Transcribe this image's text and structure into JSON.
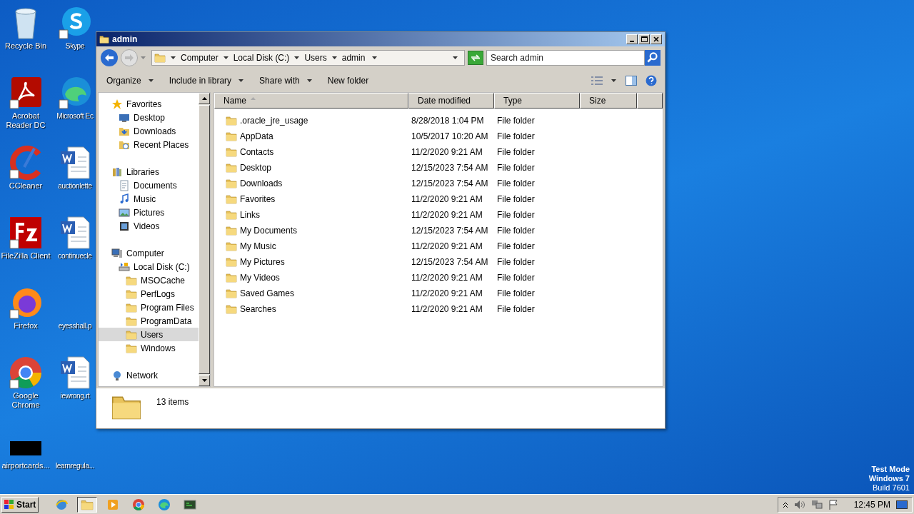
{
  "desktop_icons": [
    {
      "label": "Recycle Bin",
      "kind": "recycle"
    },
    {
      "label": "Skype",
      "kind": "skype"
    },
    {
      "label": "Acrobat Reader DC",
      "kind": "acrobat"
    },
    {
      "label": "Microsoft Ec",
      "kind": "edge"
    },
    {
      "label": "CCleaner",
      "kind": "ccleaner"
    },
    {
      "label": "auctionlette",
      "kind": "word"
    },
    {
      "label": "FileZilla Client",
      "kind": "filezilla"
    },
    {
      "label": "continuecle",
      "kind": "word"
    },
    {
      "label": "Firefox",
      "kind": "firefox"
    },
    {
      "label": "eyesshall.p",
      "kind": "blank"
    },
    {
      "label": "Google Chrome",
      "kind": "chrome"
    },
    {
      "label": "iewrong.rt",
      "kind": "word"
    },
    {
      "label": "airportcards...",
      "kind": "redacted"
    },
    {
      "label": "learnregula...",
      "kind": "blank"
    }
  ],
  "window": {
    "title": "admin",
    "breadcrumbs": [
      "Computer",
      "Local Disk (C:)",
      "Users",
      "admin"
    ],
    "search": {
      "placeholder": "Search admin"
    },
    "toolbar": [
      {
        "label": "Organize",
        "dropdown": true
      },
      {
        "label": "Include in library",
        "dropdown": true
      },
      {
        "label": "Share with",
        "dropdown": true
      },
      {
        "label": "New folder",
        "dropdown": false
      }
    ],
    "nav": [
      {
        "label": "Favorites",
        "kind": "star",
        "selected": false,
        "children": [
          {
            "label": "Desktop",
            "kind": "desktop",
            "selected": false
          },
          {
            "label": "Downloads",
            "kind": "download",
            "selected": false
          },
          {
            "label": "Recent Places",
            "kind": "recent",
            "selected": false
          }
        ]
      },
      {
        "label": "Libraries",
        "kind": "library",
        "selected": false,
        "children": [
          {
            "label": "Documents",
            "kind": "docs",
            "selected": false
          },
          {
            "label": "Music",
            "kind": "music",
            "selected": false
          },
          {
            "label": "Pictures",
            "kind": "pictures",
            "selected": false
          },
          {
            "label": "Videos",
            "kind": "videos",
            "selected": false
          }
        ]
      },
      {
        "label": "Computer",
        "kind": "computer",
        "selected": false,
        "children": [
          {
            "label": "Local Disk (C:)",
            "kind": "disk",
            "selected": false,
            "children": [
              {
                "label": "MSOCache",
                "kind": "folder",
                "selected": false
              },
              {
                "label": "PerfLogs",
                "kind": "folder",
                "selected": false
              },
              {
                "label": "Program Files",
                "kind": "folder",
                "selected": false
              },
              {
                "label": "ProgramData",
                "kind": "folder",
                "selected": false
              },
              {
                "label": "Users",
                "kind": "folder",
                "selected": true
              },
              {
                "label": "Windows",
                "kind": "folder",
                "selected": false
              }
            ]
          }
        ]
      },
      {
        "label": "Network",
        "kind": "network",
        "selected": false
      }
    ],
    "columns": [
      {
        "label": "Name",
        "sorted": true
      },
      {
        "label": "Date modified",
        "sorted": false
      },
      {
        "label": "Type",
        "sorted": false
      },
      {
        "label": "Size",
        "sorted": false
      }
    ],
    "rows": [
      {
        "name": ".oracle_jre_usage",
        "date": "8/28/2018 1:04 PM",
        "type": "File folder"
      },
      {
        "name": "AppData",
        "date": "10/5/2017 10:20 AM",
        "type": "File folder"
      },
      {
        "name": "Contacts",
        "date": "11/2/2020 9:21 AM",
        "type": "File folder"
      },
      {
        "name": "Desktop",
        "date": "12/15/2023 7:54 AM",
        "type": "File folder"
      },
      {
        "name": "Downloads",
        "date": "12/15/2023 7:54 AM",
        "type": "File folder"
      },
      {
        "name": "Favorites",
        "date": "11/2/2020 9:21 AM",
        "type": "File folder"
      },
      {
        "name": "Links",
        "date": "11/2/2020 9:21 AM",
        "type": "File folder"
      },
      {
        "name": "My Documents",
        "date": "12/15/2023 7:54 AM",
        "type": "File folder"
      },
      {
        "name": "My Music",
        "date": "11/2/2020 9:21 AM",
        "type": "File folder"
      },
      {
        "name": "My Pictures",
        "date": "12/15/2023 7:54 AM",
        "type": "File folder"
      },
      {
        "name": "My Videos",
        "date": "11/2/2020 9:21 AM",
        "type": "File folder"
      },
      {
        "name": "Saved Games",
        "date": "11/2/2020 9:21 AM",
        "type": "File folder"
      },
      {
        "name": "Searches",
        "date": "11/2/2020 9:21 AM",
        "type": "File folder"
      }
    ],
    "status": "13 items"
  },
  "taskbar": {
    "start": "Start",
    "apps": [
      {
        "kind": "ie",
        "active": false
      },
      {
        "kind": "explorer",
        "active": true
      },
      {
        "kind": "media",
        "active": false
      },
      {
        "kind": "chrome",
        "active": false
      },
      {
        "kind": "edge",
        "active": false
      },
      {
        "kind": "terminal",
        "active": false
      }
    ],
    "clock": "12:45 PM"
  },
  "watermark_lines": [
    "Test Mode",
    "Windows 7",
    "Build 7601"
  ]
}
